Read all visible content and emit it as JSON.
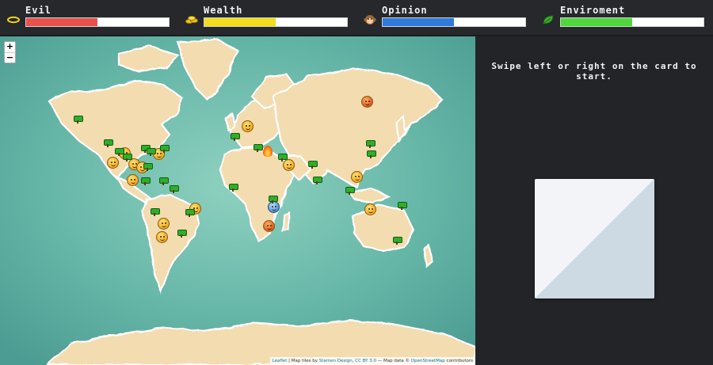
{
  "stats": [
    {
      "name": "Evil",
      "icon": "halo-icon",
      "value": 0.5,
      "color": "#e8514c"
    },
    {
      "name": "Wealth",
      "icon": "coins-icon",
      "value": 0.5,
      "color": "#f3dd1c"
    },
    {
      "name": "Opinion",
      "icon": "monkey-face-icon",
      "value": 0.5,
      "color": "#2f7ad9"
    },
    {
      "name": "Enviroment",
      "icon": "leaf-icon",
      "value": 0.5,
      "color": "#4fd83c"
    }
  ],
  "map": {
    "zoom_in": "+",
    "zoom_out": "−",
    "attribution": {
      "leaflet": "Leaflet",
      "tiles_prefix": " | Map tiles by ",
      "stamen": "Stamen Design",
      "cc": "CC BY 3.0",
      "data_prefix": " — Map data © ",
      "osm": "OpenStreetMap",
      "contributors": " contributors"
    }
  },
  "panel": {
    "prompt_line1": "Swipe left or right on the card to",
    "prompt_line2": "start."
  },
  "colors": {
    "card_light": "#f2f4f8",
    "card_dark": "#cddae3",
    "ocean": "#6fbfb1",
    "land": "#f3dcb0"
  }
}
